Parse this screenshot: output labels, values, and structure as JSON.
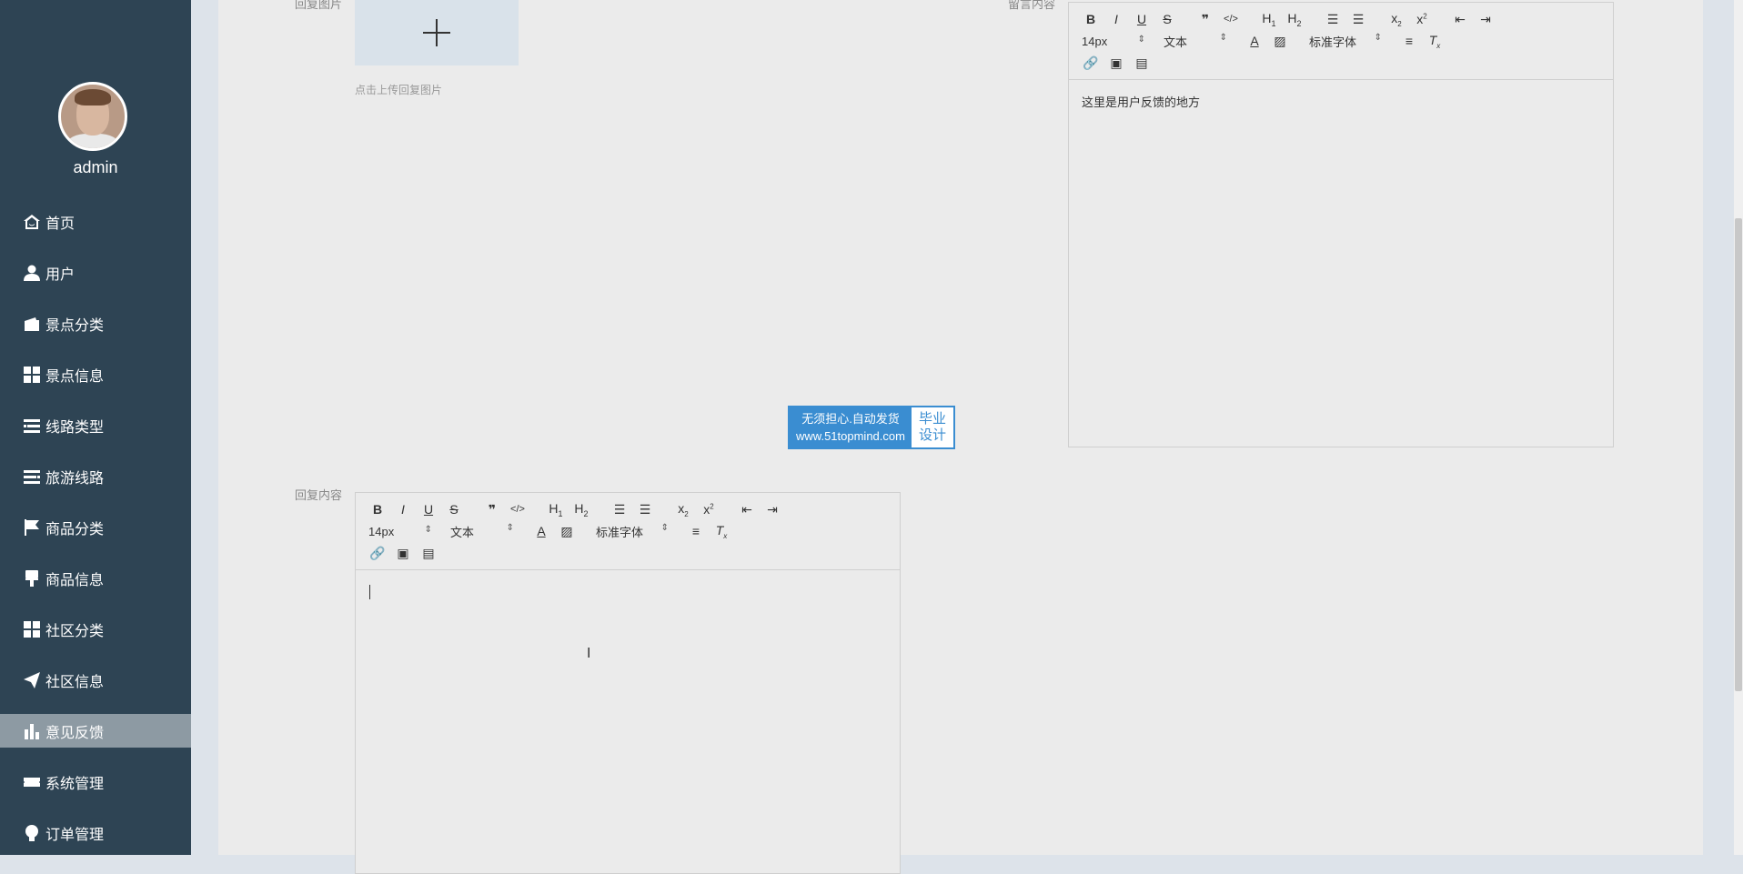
{
  "sidebar": {
    "username": "admin",
    "items": [
      {
        "label": "首页",
        "icon": "home-icon"
      },
      {
        "label": "用户",
        "icon": "user-icon"
      },
      {
        "label": "景点分类",
        "icon": "wallet-icon"
      },
      {
        "label": "景点信息",
        "icon": "grid-icon"
      },
      {
        "label": "线路类型",
        "icon": "list-icon"
      },
      {
        "label": "旅游线路",
        "icon": "list-icon"
      },
      {
        "label": "商品分类",
        "icon": "flag-icon"
      },
      {
        "label": "商品信息",
        "icon": "brush-icon"
      },
      {
        "label": "社区分类",
        "icon": "grid-icon"
      },
      {
        "label": "社区信息",
        "icon": "send-icon"
      },
      {
        "label": "意见反馈",
        "icon": "bar-chart-icon",
        "active": true
      },
      {
        "label": "系统管理",
        "icon": "ticket-icon"
      },
      {
        "label": "订单管理",
        "icon": "lightbulb-icon"
      }
    ]
  },
  "form": {
    "reply_image_label": "回复图片",
    "upload_hint": "点击上传回复图片",
    "message_label": "留言内容",
    "message_text": "这里是用户反馈的地方",
    "reply_content_label": "回复内容"
  },
  "editor_toolbar": {
    "font_size": "14px",
    "block_type": "文本",
    "font_family": "标准字体"
  },
  "watermark": {
    "line1": "无须担心.自动发货",
    "line2": "www.51topmind.com",
    "right1": "毕业",
    "right2": "设计"
  }
}
